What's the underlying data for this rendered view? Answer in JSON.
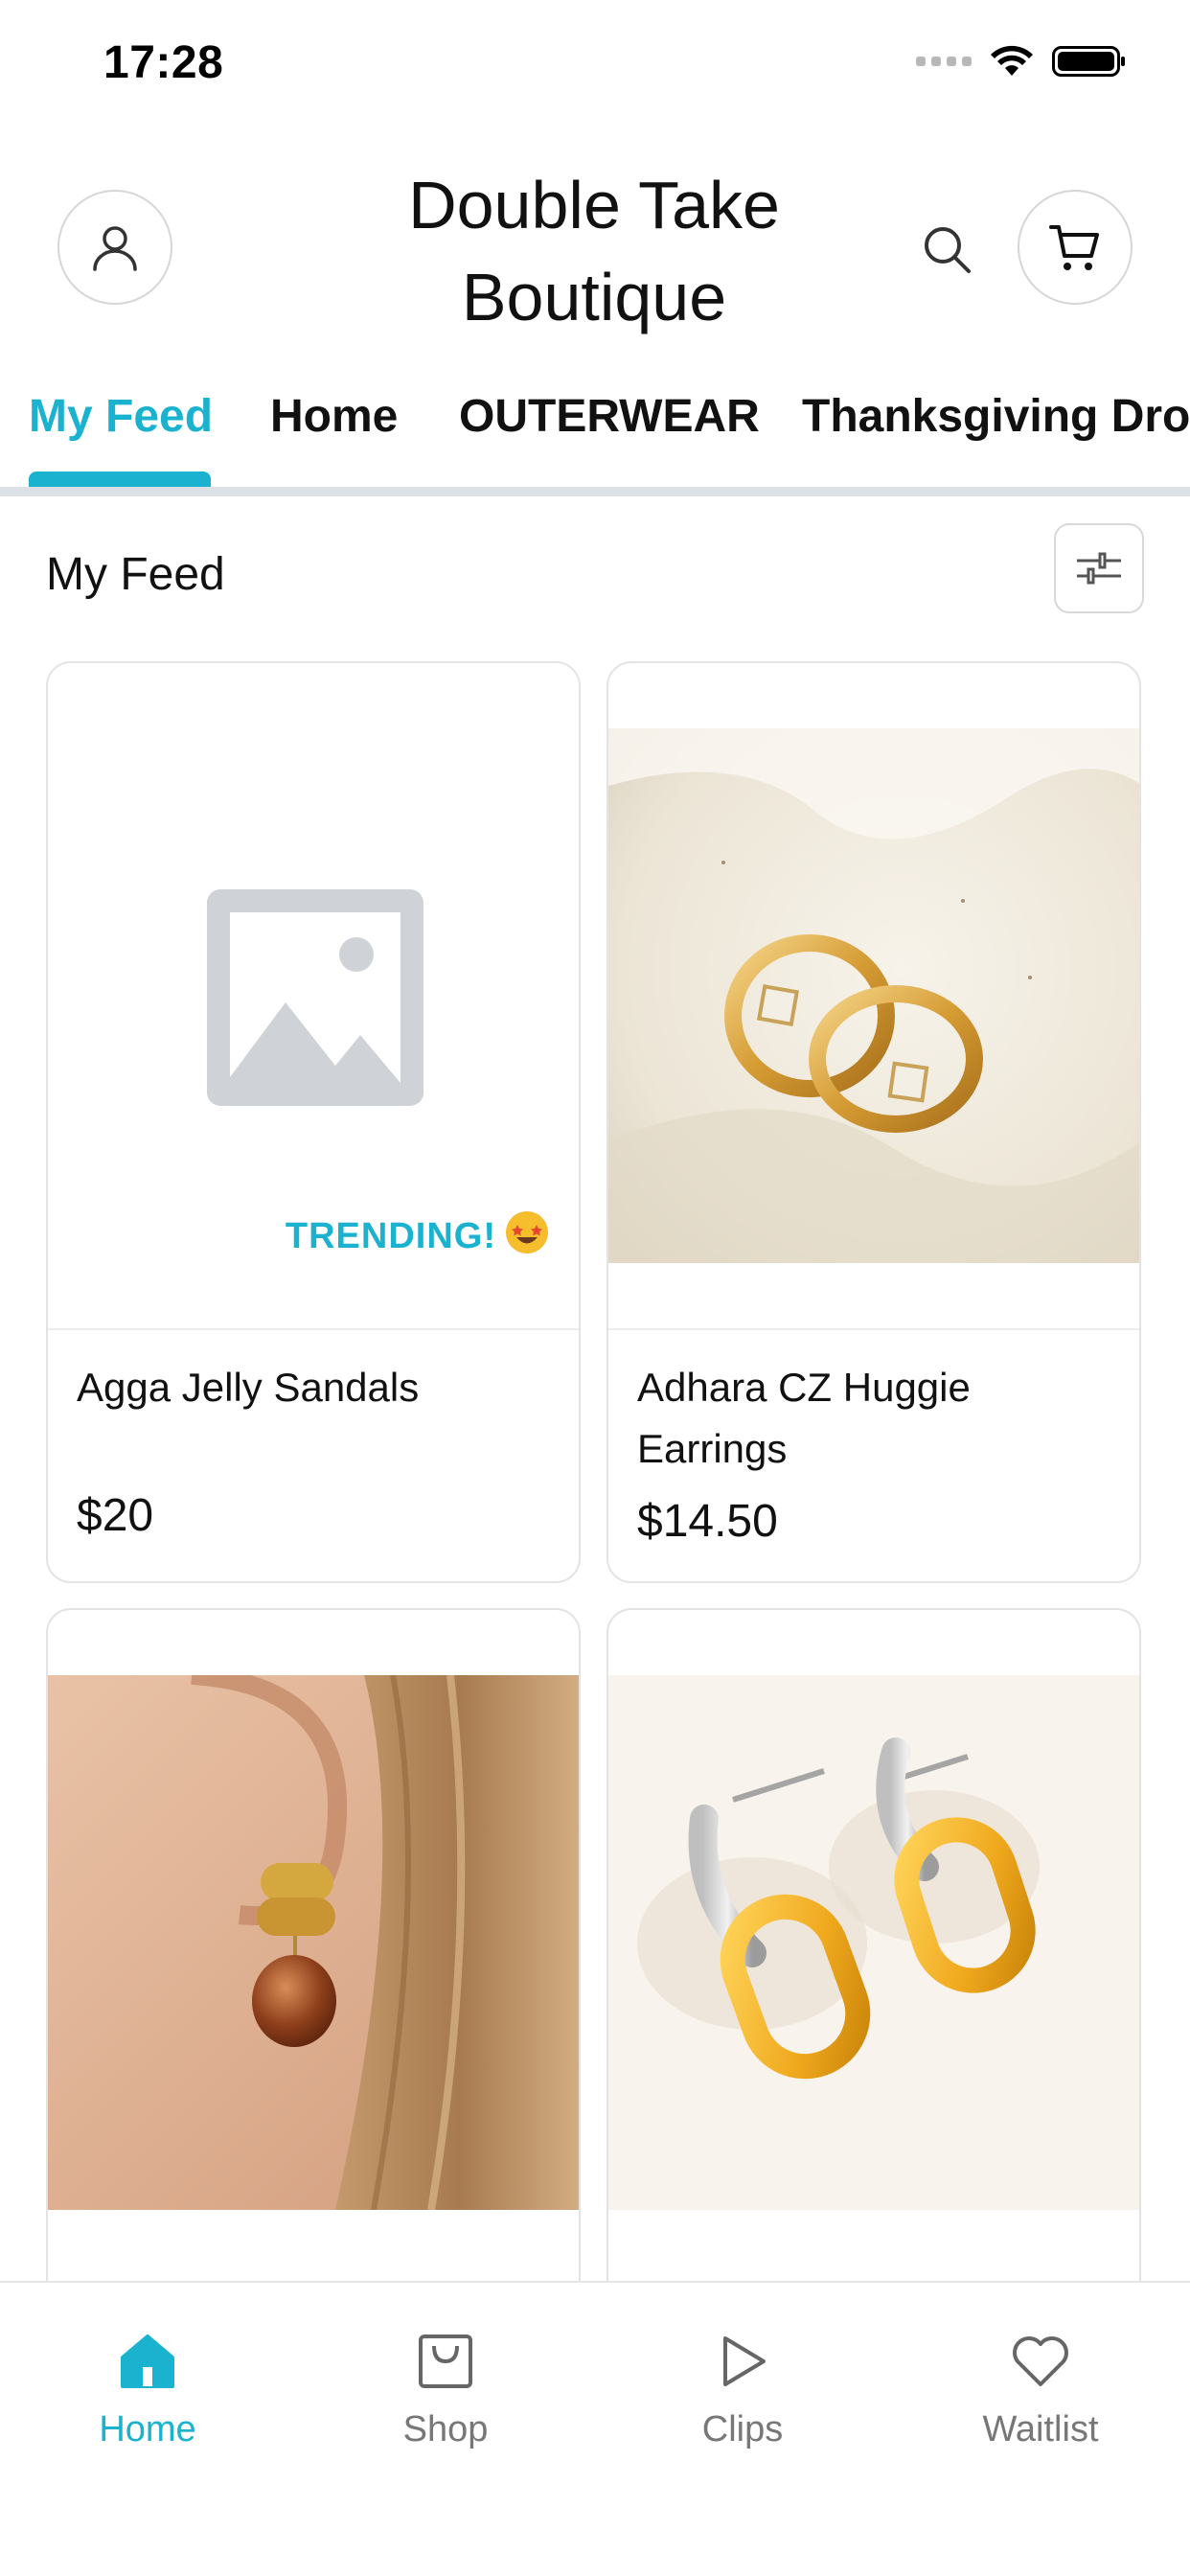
{
  "status_bar": {
    "time": "17:28",
    "icons": [
      "signal-dots-icon",
      "wifi-icon",
      "battery-icon"
    ]
  },
  "header": {
    "title_line1": "Double Take",
    "title_line2": "Boutique",
    "profile_icon": "person-icon",
    "search_icon": "search-icon",
    "cart_icon": "cart-icon"
  },
  "tabs": [
    {
      "label": "My Feed",
      "active": true
    },
    {
      "label": "Home",
      "active": false
    },
    {
      "label": "OUTERWEAR",
      "active": false
    },
    {
      "label": "Thanksgiving Drop",
      "active": false
    }
  ],
  "section": {
    "title": "My Feed",
    "filter_icon": "sliders-icon"
  },
  "products": [
    {
      "name": "Agga Jelly Sandals",
      "price": "$20",
      "image": "image-placeholder-icon",
      "badge": "TRENDING!"
    },
    {
      "name": "Adhara CZ Huggie Earrings",
      "price": "$14.50",
      "image": "gold-huggie-earrings-photo"
    },
    {
      "name": "",
      "price": "",
      "image": "gold-amber-drop-earring-photo"
    },
    {
      "name": "",
      "price": "",
      "image": "two-tone-link-earrings-photo"
    }
  ],
  "bottom_nav": [
    {
      "label": "Home",
      "icon": "home-icon",
      "active": true
    },
    {
      "label": "Shop",
      "icon": "shopping-bag-icon",
      "active": false
    },
    {
      "label": "Clips",
      "icon": "play-icon",
      "active": false
    },
    {
      "label": "Waitlist",
      "icon": "heart-icon",
      "active": false
    }
  ],
  "colors": {
    "accent": "#1ab2cf",
    "divider": "#dde1e6",
    "inactive": "#777777"
  }
}
